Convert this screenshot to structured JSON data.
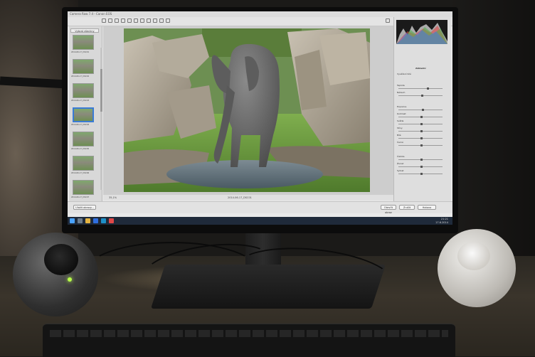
{
  "app": {
    "title": "Camera Raw 7.4 - Canon EOS",
    "film_header": "Vybrat všechny",
    "thumb_captions": [
      "2014-06-17_DSC01",
      "2014-06-17_DSC02",
      "2014-06-17_DSC03",
      "2014-06-17_DSC04",
      "2014-06-17_DSC05",
      "2014-06-17_DSC06",
      "2014-06-17_DSC07"
    ],
    "zoom": "35,1%",
    "filename": "2014-06-17_DSC01",
    "panel_title": "Základní",
    "panel_labels": [
      "Vyvážení bílé",
      "Teplota",
      "Nádech",
      "Expozice",
      "Kontrast",
      "Světla",
      "Stíny",
      "Bílé",
      "Černé",
      "Čistota",
      "Živost",
      "Sytost"
    ],
    "buttons": {
      "done": "Hotovo",
      "cancel": "Zrušit",
      "open": "Otevřít obraz",
      "save": "Uložit obrazy..."
    },
    "clock_time": "21:21",
    "clock_date": "17.6.2014"
  },
  "colors": {
    "accent": "#3a7bd5",
    "taskbar": "#1f2a3a",
    "led": "#b8ff4a"
  }
}
